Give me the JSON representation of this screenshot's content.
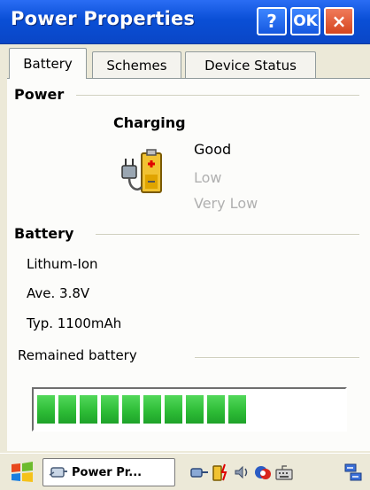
{
  "window": {
    "title": "Power Properties",
    "help_label": "?",
    "ok_label": "OK",
    "close_label": "×"
  },
  "tabs": [
    {
      "label": "Battery",
      "active": true
    },
    {
      "label": "Schemes",
      "active": false
    },
    {
      "label": "Device Status",
      "active": false
    }
  ],
  "power": {
    "section_label": "Power",
    "status_label": "Charging",
    "levels": {
      "good": "Good",
      "low": "Low",
      "very_low": "Very Low"
    }
  },
  "battery": {
    "section_label": "Battery",
    "type": "Lithum-Ion",
    "average_voltage": "Ave. 3.8V",
    "typical_capacity": "Typ. 1100mAh",
    "remained_label": "Remained battery",
    "remained_level": 0.78,
    "segments_filled": 10
  },
  "taskbar": {
    "task_label": "Power Pr...",
    "tray_icons": [
      "network-icon",
      "battery-charging-icon",
      "volume-icon",
      "sync-icon",
      "keyboard-icon",
      "window-switch-icon"
    ]
  },
  "colors": {
    "titlebar": "#0a4fd6",
    "close_button": "#d5461f",
    "progress_green": "#2cbb35",
    "disabled_text": "#b0b0b0"
  }
}
